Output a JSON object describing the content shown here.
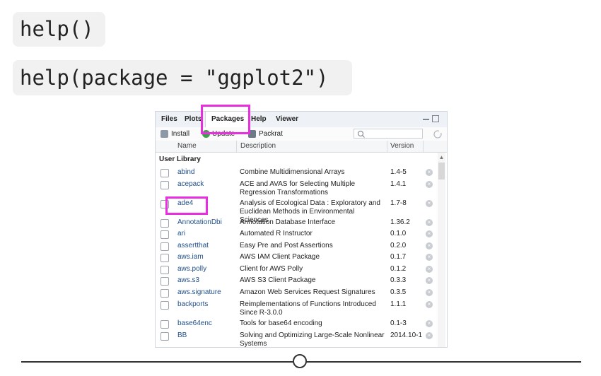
{
  "code": {
    "line1": "help()",
    "line2": "help(package = \"ggplot2\")"
  },
  "pane": {
    "tabs": [
      "Files",
      "Plots",
      "Packages",
      "Help",
      "Viewer"
    ],
    "active_tab": "Packages",
    "toolbar": {
      "install": "Install",
      "update": "Update",
      "packrat": "Packrat"
    },
    "columns": {
      "name": "Name",
      "description": "Description",
      "version": "Version"
    },
    "section": "User Library",
    "packages": [
      {
        "name": "abind",
        "description": "Combine Multidimensional Arrays",
        "version": "1.4-5"
      },
      {
        "name": "acepack",
        "description": "ACE and AVAS for Selecting Multiple Regression Transformations",
        "version": "1.4.1"
      },
      {
        "name": "ade4",
        "description": "Analysis of Ecological Data : Exploratory and Euclidean Methods in Environmental Sciences",
        "version": "1.7-8"
      },
      {
        "name": "AnnotationDbi",
        "description": "Annotation Database Interface",
        "version": "1.36.2"
      },
      {
        "name": "ari",
        "description": "Automated R Instructor",
        "version": "0.1.0"
      },
      {
        "name": "assertthat",
        "description": "Easy Pre and Post Assertions",
        "version": "0.2.0"
      },
      {
        "name": "aws.iam",
        "description": "AWS IAM Client Package",
        "version": "0.1.7"
      },
      {
        "name": "aws.polly",
        "description": "Client for AWS Polly",
        "version": "0.1.2"
      },
      {
        "name": "aws.s3",
        "description": "AWS S3 Client Package",
        "version": "0.3.3"
      },
      {
        "name": "aws.signature",
        "description": "Amazon Web Services Request Signatures",
        "version": "0.3.5"
      },
      {
        "name": "backports",
        "description": "Reimplementations of Functions Introduced Since R-3.0.0",
        "version": "1.1.1"
      },
      {
        "name": "base64enc",
        "description": "Tools for base64 encoding",
        "version": "0.1-3"
      },
      {
        "name": "BB",
        "description": "Solving and Optimizing Large-Scale Nonlinear Systems",
        "version": "2014.10-1"
      }
    ]
  },
  "colors": {
    "highlight": "#e92ee0",
    "package_link": "#1f4f8a",
    "code_background": "#f1f1f1"
  }
}
